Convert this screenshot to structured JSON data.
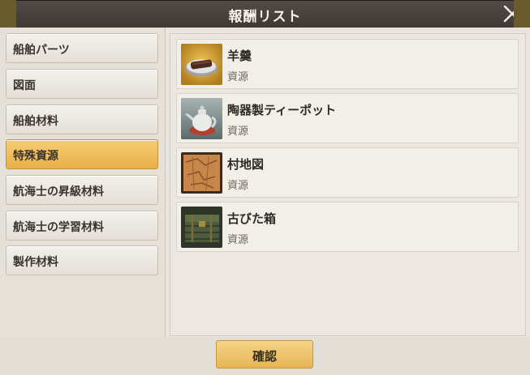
{
  "window": {
    "title": "報酬リスト"
  },
  "sidebar": {
    "items": [
      {
        "label": "船舶パーツ",
        "active": false
      },
      {
        "label": "図面",
        "active": false
      },
      {
        "label": "船舶材料",
        "active": false
      },
      {
        "label": "特殊資源",
        "active": true
      },
      {
        "label": "航海士の昇級材料",
        "active": false
      },
      {
        "label": "航海士の学習材料",
        "active": false
      },
      {
        "label": "製作材料",
        "active": false
      }
    ]
  },
  "rewards": [
    {
      "name": "羊羹",
      "category": "資源",
      "icon": "yokan-icon"
    },
    {
      "name": "陶器製ティーポット",
      "category": "資源",
      "icon": "teapot-icon"
    },
    {
      "name": "村地図",
      "category": "資源",
      "icon": "village-map-icon"
    },
    {
      "name": "古びた箱",
      "category": "資源",
      "icon": "old-box-icon"
    }
  ],
  "footer": {
    "confirm_label": "確認"
  },
  "colors": {
    "active_tab": "#f0c064",
    "title_bar": "#4a423c",
    "confirm_button": "#eec36e"
  }
}
